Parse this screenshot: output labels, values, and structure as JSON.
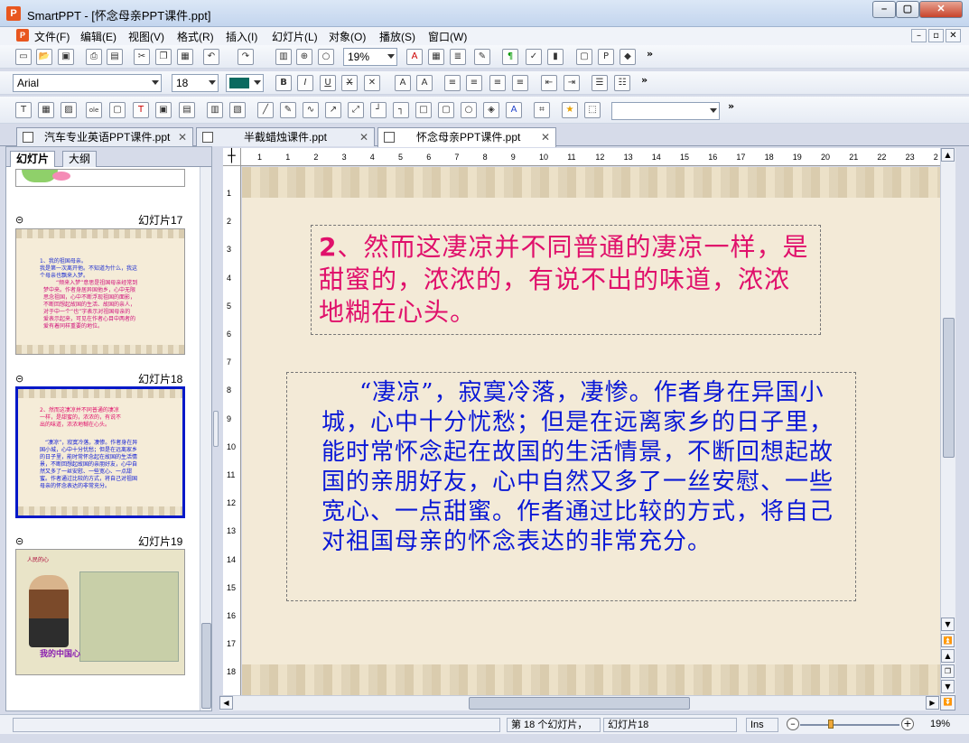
{
  "window": {
    "app_icon": "P",
    "title": "SmartPPT - [怀念母亲PPT课件.ppt]",
    "min": "–",
    "max": "▢",
    "close": "✕"
  },
  "menu": [
    "文件(F)",
    "编辑(E)",
    "视图(V)",
    "格式(R)",
    "插入(I)",
    "幻灯片(L)",
    "对象(O)",
    "播放(S)",
    "窗口(W)"
  ],
  "mdi_buttons": [
    "–",
    "▫",
    "✕"
  ],
  "toolbar1": {
    "zoom": "19%",
    "more": "»"
  },
  "toolbar2": {
    "font": "Arial",
    "size": "18",
    "more": "»"
  },
  "toolbar3": {
    "more": "»"
  },
  "tabs": [
    "汽车专业英语PPT课件.ppt",
    "半截蜡烛课件.ppt",
    "怀念母亲PPT课件.ppt"
  ],
  "tab_close": "✕",
  "panel": {
    "tab_slides": "幻灯片",
    "tab_outline": "大纲",
    "transition_icon": "⊝"
  },
  "thumbs": [
    {
      "label": "幻灯片17",
      "lines": [
        "1、我的祖国母亲。",
        "我是第一次离开他。不知道为什么，我这",
        "个母亲也飘来入梦。",
        "“频来入梦”意思是祖国母亲经常到",
        "梦中来。作者身居异国他乡，心中无限",
        "思念祖国，心中不断浮现祖国的面影，",
        "不断回想起故国的生活、故国的亲人，",
        "对于中一个“也”字表示对祖国母亲的",
        "爱表示起来，可见在作者心目中两者的",
        "爱有着同样重要的地位。"
      ]
    },
    {
      "label": "幻灯片18",
      "lines": [
        "2、然而这凄凉并不同普通的凄凉",
        "一样，是甜蜜的，浓浓的，有说不",
        "出的味道，浓浓地糊在心头。",
        "“凄凉”，寂寞冷落，凄惨。作者身在异",
        "国小城，心中十分忧愁；但是在远离家乡",
        "的日子里，能时常怀念起在故国的生活情",
        "景，不断回想起故国的亲朋好友，心中自",
        "然又多了一丝安慰、一些宽心、一点甜",
        "蜜。作者通过比较的方式，将自己对祖国",
        "母亲的怀念表达的非常充分。"
      ]
    },
    {
      "label": "幻灯片19",
      "caption": "我的中国心",
      "header": "人民的心"
    }
  ],
  "slide": {
    "title_num": "2",
    "title_text": "、然而这凄凉并不同普通的凄凉一样，是甜蜜的，浓浓的，有说不出的味道，浓浓地糊在心头。",
    "body": "“凄凉”，寂寞冷落，凄惨。作者身在异国小城，心中十分忧愁；但是在远离家乡的日子里，能时常怀念起在故国的生活情景，不断回想起故国的亲朋好友，心中自然又多了一丝安慰、一些宽心、一点甜蜜。作者通过比较的方式，将自己对祖国母亲的怀念表达的非常充分。"
  },
  "ruler_h": [
    "1",
    "1",
    "2",
    "3",
    "4",
    "5",
    "6",
    "7",
    "8",
    "9",
    "10",
    "11",
    "12",
    "13",
    "14",
    "15",
    "16",
    "17",
    "18",
    "19",
    "20",
    "21",
    "22",
    "23",
    "2"
  ],
  "ruler_v": [
    "1",
    "2",
    "3",
    "4",
    "5",
    "6",
    "7",
    "8",
    "9",
    "10",
    "11",
    "12",
    "13",
    "14",
    "15",
    "16",
    "17",
    "18"
  ],
  "ruler_corner": "┼",
  "status": {
    "slide_count": "第 18 个幻灯片，",
    "slide_name": "幻灯片18",
    "ins": "Ins",
    "zoom": "19%",
    "zoom_out": "–",
    "zoom_in": "+"
  },
  "colors": {
    "title": "#e0106b",
    "body": "#0a18d6",
    "selection": "#0018c8"
  }
}
